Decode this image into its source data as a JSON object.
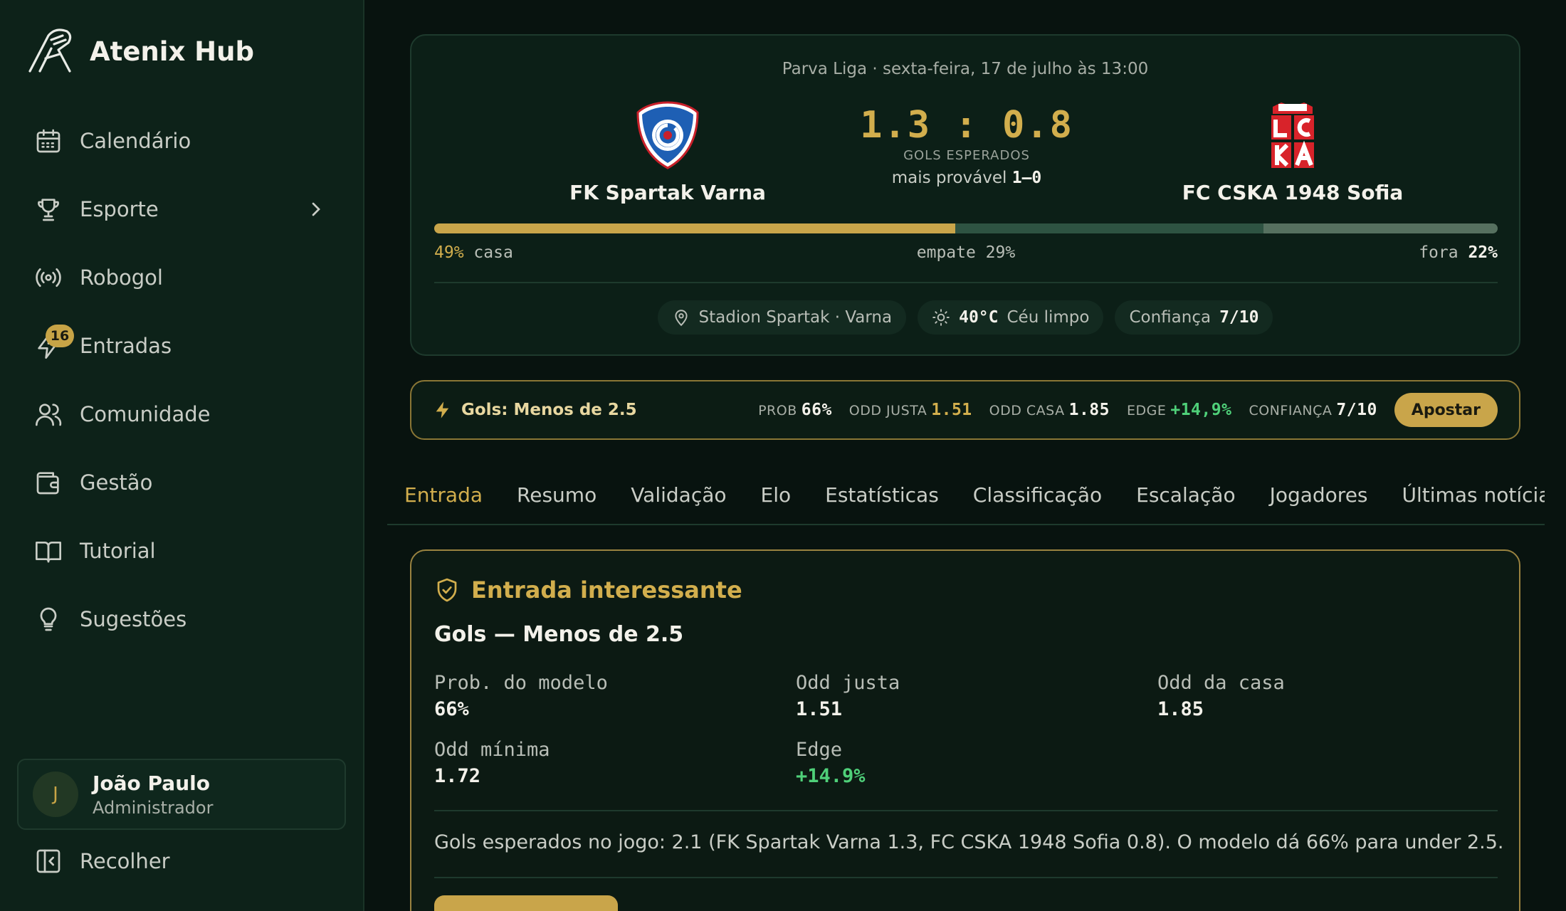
{
  "brand": {
    "name": "Atenix Hub"
  },
  "sidebar": {
    "items": [
      {
        "label": "Calendário",
        "icon": "calendar-icon"
      },
      {
        "label": "Esporte",
        "icon": "trophy-icon"
      },
      {
        "label": "Robogol",
        "icon": "broadcast-icon"
      },
      {
        "label": "Entradas",
        "icon": "bolt-icon",
        "badge": "16"
      },
      {
        "label": "Comunidade",
        "icon": "users-icon"
      },
      {
        "label": "Gestão",
        "icon": "wallet-icon"
      },
      {
        "label": "Tutorial",
        "icon": "book-icon"
      },
      {
        "label": "Sugestões",
        "icon": "lightbulb-icon"
      }
    ],
    "user": {
      "initial": "J",
      "name": "João Paulo",
      "role": "Administrador"
    },
    "collapse_label": "Recolher"
  },
  "match": {
    "league": "Parva Liga · sexta-feira, 17 de julho às 13:00",
    "home": {
      "name": "FK Spartak Varna"
    },
    "away": {
      "name": "FC CSKA 1948 Sofia"
    },
    "xg_score": "1.3 : 0.8",
    "xg_label": "GOLS ESPERADOS",
    "likely_prefix": "mais provável",
    "likely_score": "1–0",
    "probabilities": {
      "home": 49,
      "draw": 29,
      "away": 22
    },
    "prob_home_value": "49%",
    "prob_home_label": "casa",
    "prob_draw_text": "empate 29%",
    "prob_away_label": "fora",
    "prob_away_value": "22%",
    "venue": "Stadion Spartak · Varna",
    "temperature": "40°C",
    "weather": "Céu limpo",
    "confidence_label": "Confiança",
    "confidence_value": "7/10",
    "colors": {
      "home": "#c9a54a",
      "draw": "#2e5342",
      "away": "#56705f"
    }
  },
  "bet": {
    "title": "Gols: Menos de 2.5",
    "prob_label": "PROB",
    "prob_value": "66%",
    "fair_label": "ODD JUSTA",
    "fair_value": "1.51",
    "house_label": "ODD CASA",
    "house_value": "1.85",
    "edge_label": "EDGE",
    "edge_value": "+14,9%",
    "conf_label": "CONFIANÇA",
    "conf_value": "7/10",
    "button_label": "Apostar"
  },
  "tabs": [
    "Entrada",
    "Resumo",
    "Validação",
    "Elo",
    "Estatísticas",
    "Classificação",
    "Escalação",
    "Jogadores",
    "Últimas notícias"
  ],
  "entry": {
    "heading": "Entrada interessante",
    "market": "Gols — Menos de 2.5",
    "metrics": [
      {
        "label": "Prob. do modelo",
        "value": "66%"
      },
      {
        "label": "Odd justa",
        "value": "1.51"
      },
      {
        "label": "Odd da casa",
        "value": "1.85"
      },
      {
        "label": "Odd mínima",
        "value": "1.72"
      },
      {
        "label": "Edge",
        "value": "+14.9%"
      }
    ],
    "description": "Gols esperados no jogo: 2.1 (FK Spartak Varna 1.3, FC CSKA 1948 Sofia 0.8). O modelo dá 66% para under 2.5."
  }
}
